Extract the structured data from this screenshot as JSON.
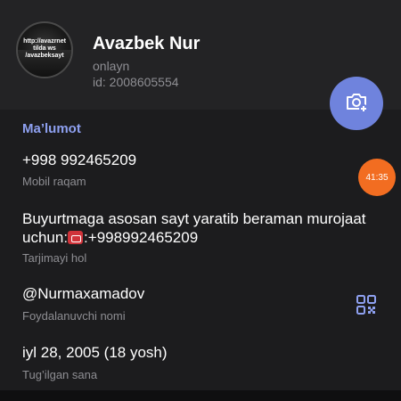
{
  "profile": {
    "avatar_text": "http://avazrnet\ntilda ws\n/avazbeksayt",
    "name": "Avazbek Nur",
    "status": "onlayn",
    "id_line": "id: 2008605554"
  },
  "info": {
    "section_title": "Ma’lumot",
    "phone": "+998 992465209",
    "phone_label": "Mobil raqam",
    "bio_text": "Buyurtmaga asosan sayt yaratib beraman murojaat uchun:",
    "bio_phone": ":+998992465209",
    "bio_label": "Tarjimayi hol",
    "username": "@Nurmaxamadov",
    "username_label": "Foydalanuvchi nomi",
    "birthday": "iyl 28, 2005 (18 yosh)",
    "birthday_label": "Tug’ilgan sana"
  },
  "overlay": {
    "timer": "41:35"
  },
  "colors": {
    "accent": "#6f83dd",
    "section_title": "#8ea0f0",
    "timer": "#f26d21",
    "background": "#1c1c1e"
  },
  "icons": {
    "camera": "camera-add-icon",
    "qr": "qr-code-icon",
    "phone_emoji": "telephone-emoji-icon"
  }
}
